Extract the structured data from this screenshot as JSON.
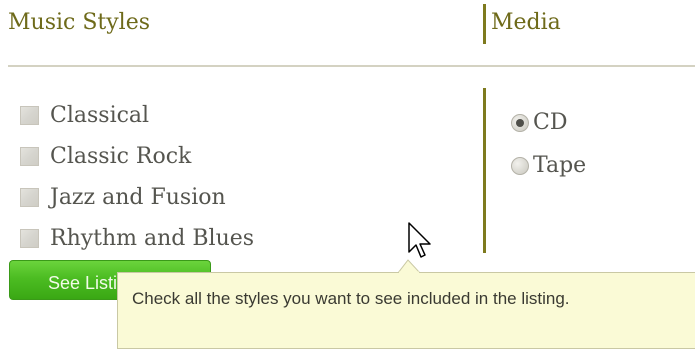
{
  "headers": {
    "music_styles": "Music Styles",
    "media": "Media"
  },
  "styles": [
    {
      "label": "Classical",
      "checked": false
    },
    {
      "label": "Classic Rock",
      "checked": false
    },
    {
      "label": "Jazz and Fusion",
      "checked": false
    },
    {
      "label": "Rhythm and Blues",
      "checked": false
    }
  ],
  "media": [
    {
      "label": "CD",
      "selected": true
    },
    {
      "label": "Tape",
      "selected": false
    }
  ],
  "button": {
    "label": "See Listings"
  },
  "tooltip": {
    "text": "Check all the styles you want to see included in the listing."
  },
  "colors": {
    "heading": "#6e6a1a",
    "divider": "#7e7a1e",
    "button_green": "#4cbc22",
    "tooltip_bg": "#fafad6"
  },
  "icons": {
    "cursor": "arrow-pointer-icon"
  }
}
